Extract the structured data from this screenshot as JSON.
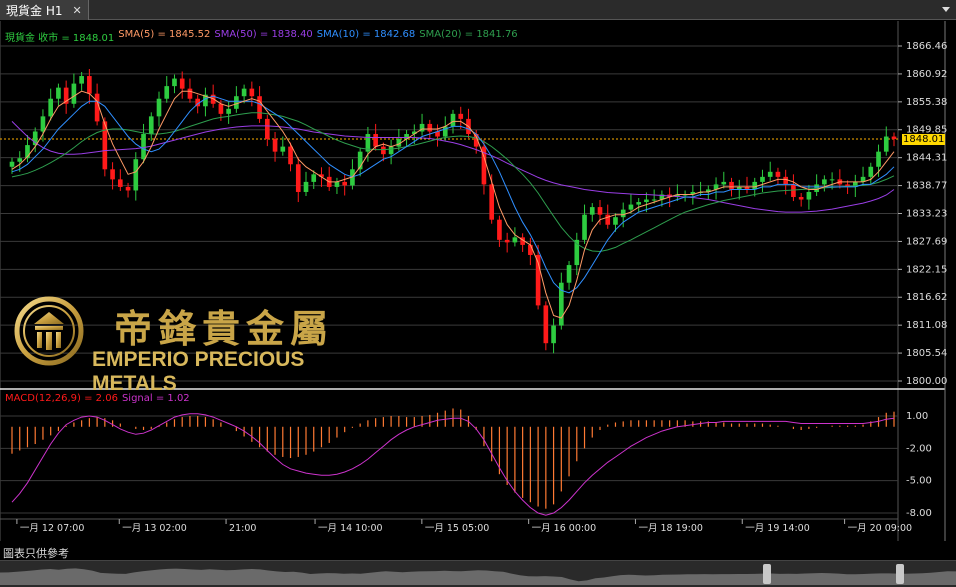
{
  "tab": {
    "title": "現貨金 H1",
    "close": "✕"
  },
  "legend": {
    "close": "現貨金 收市 = 1848.01",
    "sma5": "SMA(5) = 1845.52",
    "sma50": "SMA(50) = 1838.40",
    "sma10": "SMA(10) = 1842.68",
    "sma20": "SMA(20) = 1841.76"
  },
  "macd_legend": {
    "macd": "MACD(12,26,9) = 2.06",
    "signal": "Signal = 1.02"
  },
  "price_tag": "1848.01",
  "footer_label": "圖表只供參考",
  "logo": {
    "cn": "帝鋒貴金屬",
    "en": "EMPERIO PRECIOUS METALS"
  },
  "colors": {
    "bull": "#2ecc40",
    "bear": "#ff1a1a",
    "sma5": "#ff9a66",
    "sma10": "#2f8fff",
    "sma20": "#2e9e4e",
    "sma50": "#9a3ee6",
    "macd": "#cc33cc",
    "hist": "#ff7a33",
    "grid": "#3a3a3a",
    "price_line": "#ffb000",
    "legend_close": "#2ecc40"
  },
  "chart_data": {
    "type": "candlestick",
    "y_ticks": [
      "1866.46",
      "1860.92",
      "1855.38",
      "1849.85",
      "1844.31",
      "1838.77",
      "1833.23",
      "1827.69",
      "1822.15",
      "1816.62",
      "1811.08",
      "1805.54",
      "1800.00"
    ],
    "macd_ticks": [
      "1.00",
      "-2.00",
      "-5.00",
      "-8.00"
    ],
    "x_ticks": [
      "一月 12 07:00",
      "一月 13 02:00",
      "21:00",
      "一月 14 10:00",
      "一月 15 05:00",
      "一月 16 00:00",
      "一月 18 19:00",
      "一月 19 14:00",
      "一月 20 09:00"
    ],
    "ylim": [
      1800,
      1866.46
    ],
    "macd_ylim": [
      -8,
      1
    ],
    "last_close": 1848.01,
    "sma_last": {
      "sma5": 1845.52,
      "sma10": 1842.68,
      "sma20": 1841.76,
      "sma50": 1838.4
    },
    "macd_last": 2.06,
    "signal_last": 1.02,
    "close": [
      1843.5,
      1844.2,
      1846.8,
      1849.5,
      1852.5,
      1856.0,
      1858.2,
      1855.0,
      1859.0,
      1860.5,
      1857.0,
      1851.5,
      1842.0,
      1840.0,
      1838.5,
      1837.8,
      1844.0,
      1849.0,
      1852.5,
      1856.0,
      1858.5,
      1860.0,
      1858.0,
      1856.0,
      1854.5,
      1856.8,
      1855.0,
      1853.0,
      1854.0,
      1856.5,
      1858.0,
      1856.5,
      1852.0,
      1848.0,
      1845.5,
      1846.5,
      1843.0,
      1837.5,
      1839.5,
      1841.0,
      1840.5,
      1838.5,
      1839.5,
      1838.8,
      1842.0,
      1845.5,
      1849.0,
      1846.5,
      1845.0,
      1846.5,
      1848.0,
      1849.0,
      1849.5,
      1851.0,
      1849.5,
      1848.5,
      1850.5,
      1853.0,
      1852.0,
      1849.0,
      1846.5,
      1839.0,
      1832.0,
      1828.0,
      1827.5,
      1828.5,
      1827.0,
      1825.0,
      1815.0,
      1807.5,
      1811.0,
      1819.5,
      1823.0,
      1828.0,
      1833.0,
      1834.5,
      1833.0,
      1831.0,
      1832.5,
      1834.0,
      1835.0,
      1835.5,
      1836.0,
      1836.0,
      1837.0,
      1836.5,
      1837.0,
      1837.0,
      1837.5,
      1837.5,
      1838.0,
      1839.0,
      1839.5,
      1838.0,
      1838.5,
      1838.0,
      1839.5,
      1840.5,
      1841.5,
      1840.5,
      1839.0,
      1836.5,
      1836.0,
      1837.5,
      1839.0,
      1840.0,
      1840.0,
      1839.0,
      1838.5,
      1839.5,
      1840.5,
      1842.5,
      1845.5,
      1848.5,
      1848.0
    ],
    "sma5": [
      1842.0,
      1843.0,
      1844.5,
      1846.5,
      1849.0,
      1852.0,
      1854.5,
      1855.5,
      1856.5,
      1857.5,
      1857.0,
      1855.5,
      1851.0,
      1847.0,
      1844.0,
      1841.0,
      1841.5,
      1843.5,
      1846.5,
      1850.0,
      1853.0,
      1856.0,
      1857.5,
      1857.5,
      1857.0,
      1856.5,
      1856.0,
      1855.0,
      1854.5,
      1855.0,
      1855.5,
      1856.0,
      1855.5,
      1853.5,
      1851.5,
      1849.5,
      1847.0,
      1844.0,
      1842.5,
      1841.5,
      1840.5,
      1839.5,
      1839.5,
      1840.0,
      1840.5,
      1842.5,
      1845.0,
      1846.5,
      1847.0,
      1846.5,
      1847.0,
      1848.0,
      1849.0,
      1850.0,
      1850.0,
      1850.0,
      1850.5,
      1851.5,
      1851.5,
      1850.5,
      1848.5,
      1844.5,
      1839.5,
      1834.5,
      1831.0,
      1829.0,
      1828.0,
      1827.0,
      1823.5,
      1817.5,
      1813.0,
      1812.5,
      1815.0,
      1820.0,
      1826.0,
      1830.0,
      1832.0,
      1832.5,
      1833.0,
      1833.0,
      1833.5,
      1834.5,
      1835.0,
      1835.5,
      1836.0,
      1836.5,
      1837.0,
      1837.0,
      1837.0,
      1837.5,
      1837.5,
      1838.0,
      1838.5,
      1838.5,
      1838.5,
      1838.5,
      1838.5,
      1839.0,
      1839.5,
      1840.0,
      1840.0,
      1839.5,
      1838.5,
      1838.0,
      1838.0,
      1838.5,
      1839.0,
      1839.5,
      1839.5,
      1839.5,
      1839.5,
      1840.0,
      1841.5,
      1843.5,
      1845.5
    ],
    "sma10": [
      1841.5,
      1842.0,
      1843.0,
      1844.5,
      1846.0,
      1848.0,
      1850.0,
      1851.5,
      1853.0,
      1854.5,
      1855.5,
      1855.5,
      1854.5,
      1852.5,
      1850.5,
      1848.5,
      1847.0,
      1846.0,
      1845.5,
      1846.0,
      1847.5,
      1849.5,
      1851.5,
      1853.5,
      1855.0,
      1856.0,
      1856.5,
      1856.0,
      1855.5,
      1855.5,
      1855.5,
      1855.5,
      1855.0,
      1854.0,
      1853.0,
      1852.0,
      1850.5,
      1849.0,
      1847.5,
      1846.0,
      1844.5,
      1843.0,
      1842.0,
      1841.0,
      1840.5,
      1841.0,
      1842.0,
      1843.0,
      1844.0,
      1844.5,
      1845.5,
      1846.5,
      1847.5,
      1848.5,
      1849.0,
      1849.5,
      1850.0,
      1850.5,
      1850.5,
      1850.0,
      1849.0,
      1847.0,
      1844.5,
      1841.5,
      1838.0,
      1834.5,
      1831.5,
      1829.0,
      1826.0,
      1822.5,
      1819.5,
      1818.0,
      1817.5,
      1818.5,
      1820.5,
      1823.0,
      1825.5,
      1828.0,
      1830.0,
      1831.5,
      1832.5,
      1833.5,
      1834.0,
      1834.5,
      1835.0,
      1835.5,
      1836.0,
      1836.5,
      1836.5,
      1837.0,
      1837.0,
      1837.5,
      1837.5,
      1838.0,
      1838.0,
      1838.0,
      1838.0,
      1838.5,
      1838.5,
      1839.0,
      1839.0,
      1839.0,
      1838.5,
      1838.5,
      1838.5,
      1838.5,
      1838.5,
      1838.5,
      1838.5,
      1838.5,
      1839.0,
      1839.0,
      1840.0,
      1841.0,
      1842.5
    ],
    "sma20": [
      1840.5,
      1840.8,
      1841.2,
      1841.8,
      1842.5,
      1843.3,
      1844.2,
      1845.2,
      1846.3,
      1847.5,
      1848.5,
      1849.3,
      1849.8,
      1850.0,
      1850.0,
      1849.8,
      1849.5,
      1849.2,
      1849.0,
      1849.0,
      1849.2,
      1849.5,
      1850.0,
      1850.5,
      1851.0,
      1851.5,
      1852.0,
      1852.3,
      1852.5,
      1852.8,
      1853.0,
      1853.2,
      1853.2,
      1853.0,
      1852.8,
      1852.5,
      1852.0,
      1851.5,
      1850.8,
      1850.0,
      1849.3,
      1848.5,
      1847.8,
      1847.2,
      1846.7,
      1846.2,
      1846.0,
      1845.9,
      1845.9,
      1846.0,
      1846.2,
      1846.5,
      1846.8,
      1847.2,
      1847.6,
      1848.0,
      1848.3,
      1848.5,
      1848.6,
      1848.5,
      1848.2,
      1847.5,
      1846.5,
      1845.3,
      1844.0,
      1842.5,
      1841.0,
      1839.3,
      1837.3,
      1835.0,
      1832.7,
      1830.5,
      1828.7,
      1827.2,
      1826.3,
      1825.8,
      1825.7,
      1826.0,
      1826.5,
      1827.3,
      1828.0,
      1828.8,
      1829.6,
      1830.4,
      1831.2,
      1832.0,
      1832.8,
      1833.5,
      1834.0,
      1834.5,
      1835.0,
      1835.4,
      1835.8,
      1836.1,
      1836.4,
      1836.7,
      1837.0,
      1837.3,
      1837.5,
      1837.7,
      1837.8,
      1837.9,
      1838.0,
      1838.1,
      1838.2,
      1838.3,
      1838.4,
      1838.5,
      1838.6,
      1838.7,
      1838.8,
      1839.0,
      1839.4,
      1840.0,
      1840.7
    ],
    "sma50": [
      1851.5,
      1850.0,
      1848.5,
      1847.3,
      1846.3,
      1845.6,
      1845.2,
      1845.0,
      1845.0,
      1845.1,
      1845.3,
      1845.5,
      1845.7,
      1845.8,
      1845.9,
      1846.0,
      1846.1,
      1846.3,
      1846.6,
      1847.0,
      1847.4,
      1847.8,
      1848.2,
      1848.6,
      1849.0,
      1849.4,
      1849.7,
      1850.0,
      1850.2,
      1850.4,
      1850.5,
      1850.6,
      1850.6,
      1850.6,
      1850.5,
      1850.4,
      1850.2,
      1850.0,
      1849.7,
      1849.4,
      1849.2,
      1849.0,
      1848.8,
      1848.6,
      1848.5,
      1848.4,
      1848.3,
      1848.3,
      1848.3,
      1848.3,
      1848.3,
      1848.3,
      1848.3,
      1848.2,
      1848.1,
      1847.9,
      1847.6,
      1847.3,
      1846.9,
      1846.4,
      1845.9,
      1845.3,
      1844.7,
      1844.0,
      1843.2,
      1842.5,
      1841.8,
      1841.1,
      1840.4,
      1839.8,
      1839.3,
      1838.9,
      1838.6,
      1838.3,
      1838.0,
      1837.8,
      1837.6,
      1837.4,
      1837.3,
      1837.2,
      1837.1,
      1837.0,
      1837.0,
      1836.9,
      1836.8,
      1836.7,
      1836.6,
      1836.5,
      1836.4,
      1836.2,
      1836.0,
      1835.7,
      1835.4,
      1835.1,
      1834.8,
      1834.5,
      1834.2,
      1834.0,
      1833.8,
      1833.6,
      1833.5,
      1833.5,
      1833.5,
      1833.6,
      1833.7,
      1833.9,
      1834.1,
      1834.4,
      1834.7,
      1835.0,
      1835.3,
      1835.7,
      1836.2,
      1836.9,
      1838.0
    ],
    "macd": [
      -7.0,
      -6.2,
      -5.2,
      -4.0,
      -2.8,
      -1.6,
      -0.6,
      0.2,
      0.6,
      0.9,
      1.0,
      0.9,
      0.6,
      0.2,
      -0.2,
      -0.5,
      -0.7,
      -0.6,
      -0.3,
      0.1,
      0.5,
      0.9,
      1.1,
      1.2,
      1.2,
      1.1,
      0.9,
      0.6,
      0.3,
      0.0,
      -0.4,
      -0.9,
      -1.5,
      -2.2,
      -2.9,
      -3.5,
      -3.9,
      -4.1,
      -4.3,
      -4.4,
      -4.5,
      -4.5,
      -4.4,
      -4.2,
      -3.9,
      -3.5,
      -3.0,
      -2.4,
      -1.8,
      -1.2,
      -0.7,
      -0.3,
      0.0,
      0.2,
      0.4,
      0.6,
      0.7,
      0.8,
      0.8,
      0.5,
      -0.2,
      -1.2,
      -2.5,
      -3.8,
      -5.0,
      -6.0,
      -6.8,
      -7.5,
      -8.0,
      -8.2,
      -8.0,
      -7.5,
      -6.8,
      -6.0,
      -5.2,
      -4.5,
      -3.9,
      -3.3,
      -2.8,
      -2.3,
      -1.8,
      -1.4,
      -1.0,
      -0.7,
      -0.4,
      -0.2,
      0.0,
      0.1,
      0.2,
      0.3,
      0.4,
      0.4,
      0.5,
      0.5,
      0.5,
      0.5,
      0.5,
      0.5,
      0.5,
      0.5,
      0.5,
      0.4,
      0.3,
      0.3,
      0.3,
      0.3,
      0.3,
      0.3,
      0.3,
      0.3,
      0.3,
      0.4,
      0.5,
      0.7,
      0.8
    ],
    "hist": [
      -2.5,
      -2.2,
      -1.9,
      -1.6,
      -1.2,
      -0.8,
      -0.4,
      0.1,
      0.4,
      0.6,
      0.8,
      0.9,
      0.8,
      0.6,
      0.3,
      0.0,
      -0.2,
      -0.3,
      -0.2,
      0.1,
      0.4,
      0.7,
      0.9,
      1.0,
      1.0,
      0.9,
      0.7,
      0.4,
      0.0,
      -0.4,
      -0.9,
      -1.4,
      -1.9,
      -2.3,
      -2.6,
      -2.8,
      -2.9,
      -2.8,
      -2.6,
      -2.3,
      -1.9,
      -1.5,
      -1.0,
      -0.5,
      -0.1,
      0.3,
      0.6,
      0.8,
      0.9,
      1.0,
      1.0,
      0.9,
      0.9,
      1.0,
      1.1,
      1.3,
      1.5,
      1.7,
      1.6,
      1.0,
      -0.3,
      -1.8,
      -3.2,
      -4.4,
      -5.4,
      -6.1,
      -6.6,
      -7.0,
      -7.4,
      -7.6,
      -7.2,
      -6.0,
      -4.6,
      -3.2,
      -2.0,
      -1.0,
      -0.3,
      0.2,
      0.4,
      0.5,
      0.6,
      0.6,
      0.6,
      0.6,
      0.6,
      0.6,
      0.6,
      0.6,
      0.5,
      0.5,
      0.5,
      0.4,
      0.4,
      0.3,
      0.3,
      0.3,
      0.3,
      0.3,
      0.2,
      0.1,
      0.0,
      -0.2,
      -0.3,
      -0.2,
      -0.1,
      0.0,
      0.1,
      0.1,
      0.1,
      0.1,
      0.2,
      0.5,
      0.9,
      1.3,
      1.4
    ]
  }
}
